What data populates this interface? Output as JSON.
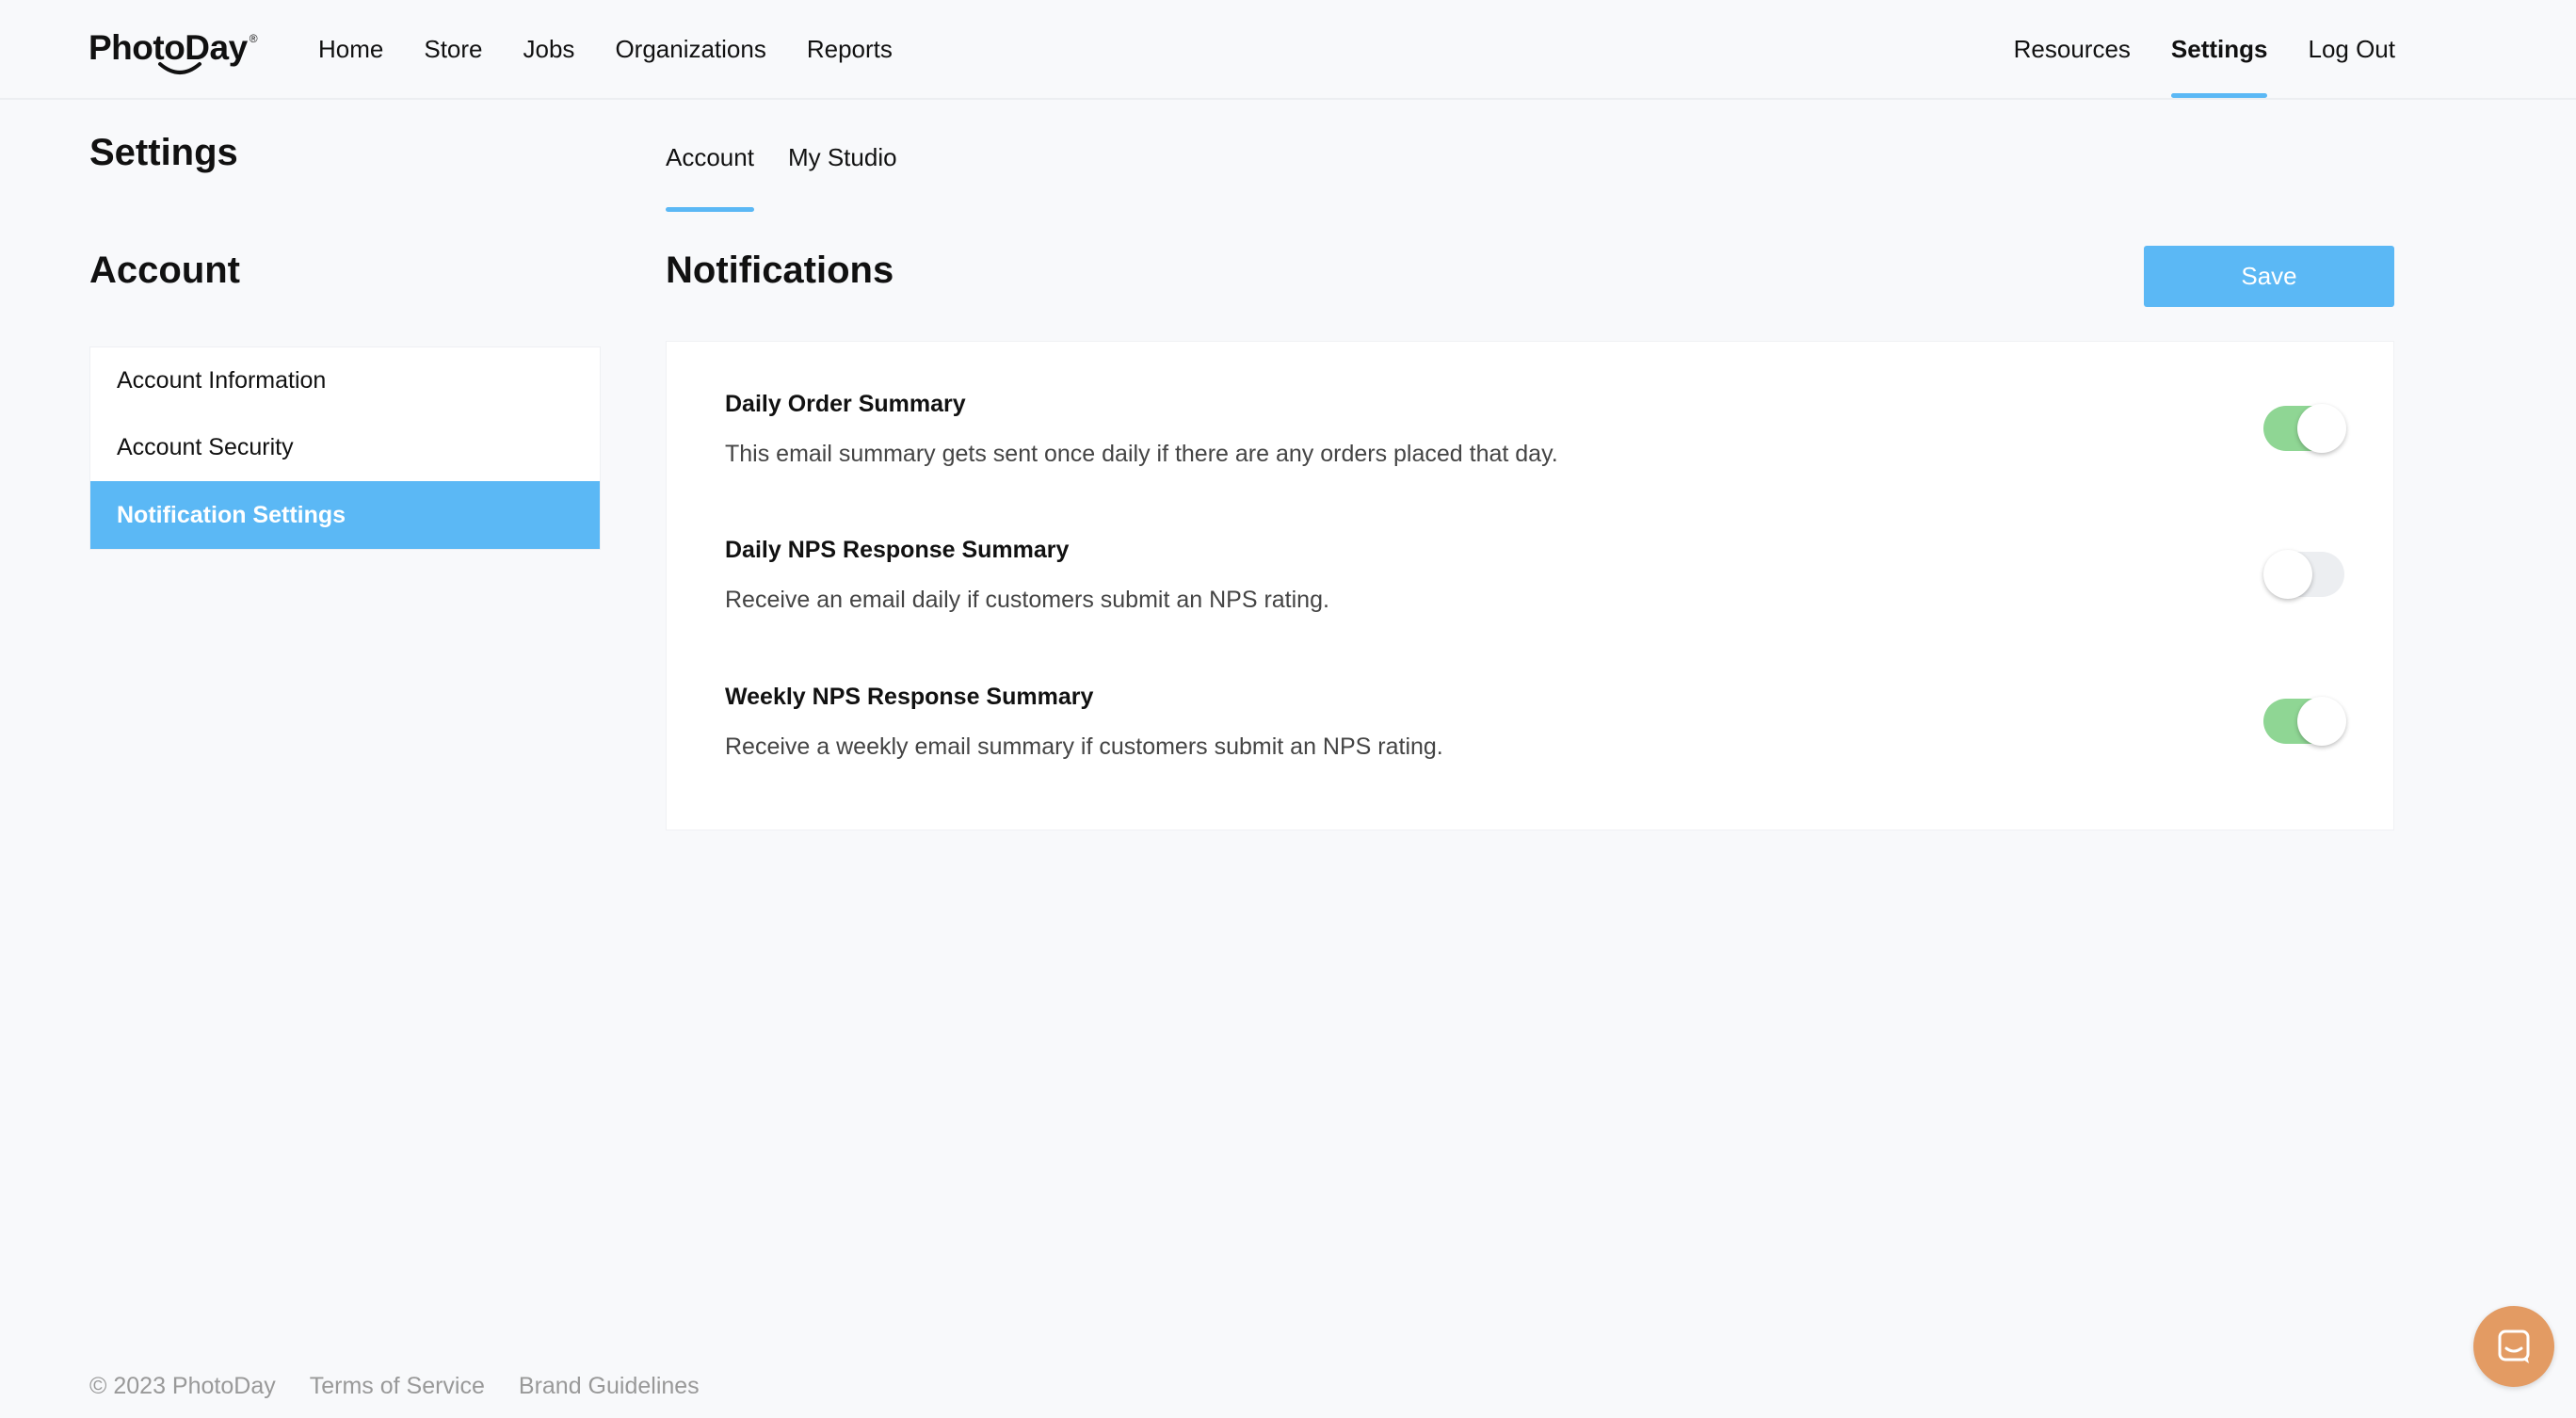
{
  "brand": {
    "name": "PhotoDay",
    "reg": "®"
  },
  "nav": {
    "left": [
      "Home",
      "Store",
      "Jobs",
      "Organizations",
      "Reports"
    ],
    "right": [
      "Resources",
      "Settings",
      "Log Out"
    ],
    "active": "Settings"
  },
  "sidebar": {
    "page_title": "Settings",
    "section_title": "Account",
    "items": [
      {
        "label": "Account Information",
        "active": false
      },
      {
        "label": "Account Security",
        "active": false
      },
      {
        "label": "Notification Settings",
        "active": true
      }
    ]
  },
  "tabs": [
    {
      "label": "Account",
      "active": true
    },
    {
      "label": "My Studio",
      "active": false
    }
  ],
  "main": {
    "title": "Notifications",
    "save_label": "Save",
    "notifications": [
      {
        "title": "Daily Order Summary",
        "description": "This email summary gets sent once daily if there are any orders placed that day.",
        "enabled": true
      },
      {
        "title": "Daily NPS Response Summary",
        "description": "Receive an email daily if customers submit an NPS rating.",
        "enabled": false
      },
      {
        "title": "Weekly NPS Response Summary",
        "description": "Receive a weekly email summary if customers submit an NPS rating.",
        "enabled": true
      }
    ]
  },
  "footer": {
    "copyright": "© 2023 PhotoDay",
    "links": [
      "Terms of Service",
      "Brand Guidelines"
    ]
  },
  "colors": {
    "accent": "#5bb8f5",
    "toggle_on": "#8fd694",
    "chat": "#e39b63"
  }
}
